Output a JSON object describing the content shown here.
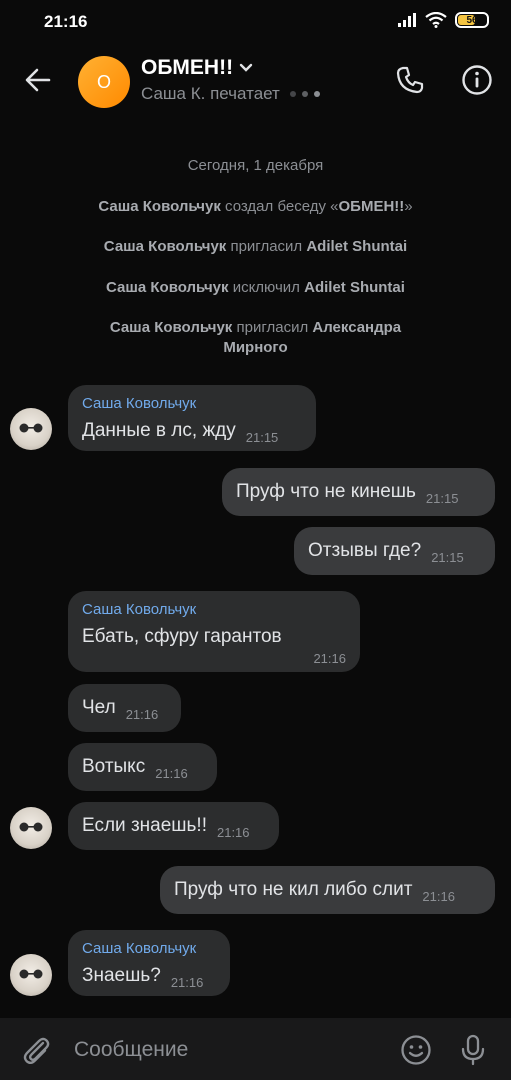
{
  "status_bar": {
    "time": "21:16",
    "battery": "56"
  },
  "header": {
    "avatar_letter": "О",
    "title": "ОБМЕН!!",
    "subtitle": "Саша К. печатает"
  },
  "service_messages": [
    {
      "text": "Сегодня, 1 декабря"
    },
    {
      "actor": "Саша Ковольчук",
      "action": " создал беседу «",
      "target": "ОБМЕН!!",
      "tail": "»"
    },
    {
      "actor": "Саша Ковольчук",
      "action": " пригласил ",
      "target": "Adilet Shuntai"
    },
    {
      "actor": "Саша Ковольчук",
      "action": " исключил ",
      "target": "Adilet Shuntai"
    },
    {
      "actor": "Саша Ковольчук",
      "action": " пригласил ",
      "target": "Александра Мирного"
    }
  ],
  "messages": [
    {
      "sender": "Саша Ковольчук",
      "text": "Данные в лс, жду",
      "time": "21:15"
    },
    {
      "text": "Пруф что не кинешь",
      "time": "21:15"
    },
    {
      "text": "Отзывы где?",
      "time": "21:15"
    },
    {
      "sender": "Саша Ковольчук",
      "text": "Ебать, сфуру гарантов",
      "time": "21:16"
    },
    {
      "text": "Чел",
      "time": "21:16"
    },
    {
      "text": "Вотыкс",
      "time": "21:16"
    },
    {
      "text": "Если знаешь!!",
      "time": "21:16"
    },
    {
      "text": "Пруф что не кил либо слит",
      "time": "21:16"
    },
    {
      "sender": "Саша Ковольчук",
      "text": "Знаешь?",
      "time": "21:16"
    }
  ],
  "composer": {
    "placeholder": "Сообщение"
  },
  "colors": {
    "accent_link": "#71aaeb",
    "avatar_orange": "#ff9e1b",
    "bubble_in": "#2c2d2e",
    "bubble_out": "#3a3b3d"
  },
  "icons": [
    "back-arrow-icon",
    "chevron-down-icon",
    "phone-icon",
    "info-icon",
    "paperclip-icon",
    "emoji-icon",
    "microphone-icon"
  ]
}
